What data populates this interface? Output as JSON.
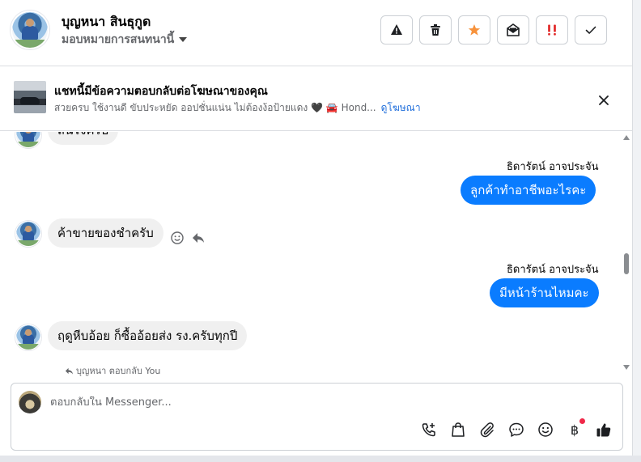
{
  "header": {
    "contact_name": "บุญหนา สินธุกูด",
    "assign_label": "มอบหมายการสนทนานี้",
    "actions": [
      {
        "icon": "warning-icon",
        "color": "#1c1e21"
      },
      {
        "icon": "trash-icon",
        "color": "#1c1e21"
      },
      {
        "icon": "star-icon",
        "color": "#f7923b"
      },
      {
        "icon": "mail-open-icon",
        "color": "#1c1e21"
      },
      {
        "icon": "priority-icon",
        "color": "#e02020"
      },
      {
        "icon": "check-icon",
        "color": "#1c1e21"
      }
    ]
  },
  "ad_banner": {
    "title": "แชทนี้มีข้อความตอบกลับต่อโฆษณาของคุณ",
    "subtitle": "สวยครบ ใช้งานดี ขับประหยัด ออปชั่นแน่น ไม่ต้องง้อป้ายแดง 🖤 🚘 Hond...",
    "link": "ดูโฆษณา"
  },
  "messages": [
    {
      "direction": "in",
      "text": "สนใจครับ"
    },
    {
      "direction": "out",
      "sender": "ธิดารัตน์ อาจประจัน",
      "text": "ลูกค้าทำอาชีพอะไรคะ"
    },
    {
      "direction": "in",
      "text": "ค้าขายของชำครับ"
    },
    {
      "direction": "out",
      "sender": "ธิดารัตน์ อาจประจัน",
      "text": "มีหน้าร้านไหมคะ"
    },
    {
      "direction": "in",
      "text": "ฤดูหีบอ้อย ก็ซื้ออ้อยส่ง รง.ครับทุกปี"
    }
  ],
  "reply_note": "บุญหนา ตอบกลับ You",
  "composer": {
    "placeholder": "ตอบกลับใน Messenger...",
    "tools": [
      "call-add-icon",
      "shopping-bag-icon",
      "paperclip-icon",
      "saved-reply-icon",
      "emoji-icon",
      "baht-icon",
      "thumbs-up-icon"
    ],
    "baht_symbol": "฿"
  },
  "colors": {
    "accent": "#0a7cff",
    "link": "#216fdb",
    "incoming_bubble": "#f0f0f0"
  }
}
